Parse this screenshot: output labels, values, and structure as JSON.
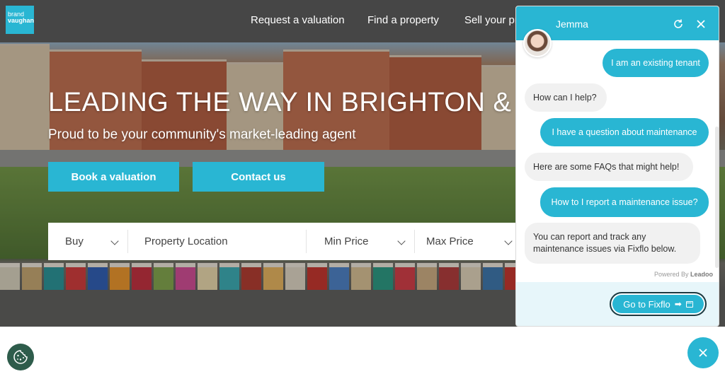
{
  "brand": {
    "logo_line1": "brand",
    "logo_line2": "vaughan"
  },
  "nav": {
    "items": [
      {
        "label": "Request a valuation"
      },
      {
        "label": "Find a property"
      },
      {
        "label": "Sell your pr"
      }
    ]
  },
  "hero": {
    "title": "LEADING THE WAY IN BRIGHTON & H",
    "subtitle": "Proud to be your community's market-leading agent",
    "cta_primary": "Book a valuation",
    "cta_secondary": "Contact us"
  },
  "search": {
    "type_value": "Buy",
    "location_placeholder": "Property Location",
    "min_price": "Min Price",
    "max_price": "Max Price"
  },
  "chat": {
    "agent_name": "Jemma",
    "messages": [
      {
        "from": "user",
        "text": "I am an existing tenant"
      },
      {
        "from": "bot",
        "text": "How can I help?"
      },
      {
        "from": "user",
        "text": "I have a question about maintenance"
      },
      {
        "from": "bot",
        "text": "Here are some FAQs that might help!"
      },
      {
        "from": "user",
        "text": "How to I report a maintenance issue?"
      },
      {
        "from": "bot",
        "text": "You can report and track any maintenance issues via Fixflo below."
      }
    ],
    "powered_by_prefix": "Powered By",
    "powered_by_brand": "Leadoo",
    "action_button": "Go to Fixflo"
  },
  "icons": {
    "refresh": "refresh-icon",
    "close": "close-icon",
    "cookie": "cookie-icon",
    "chevron": "chevron-down-icon",
    "external": "external-link-icon"
  },
  "colors": {
    "accent": "#29b6d3",
    "topbar": "#464646",
    "cookie_button": "#2e5c4b",
    "bot_bubble": "#f1f1f1"
  }
}
